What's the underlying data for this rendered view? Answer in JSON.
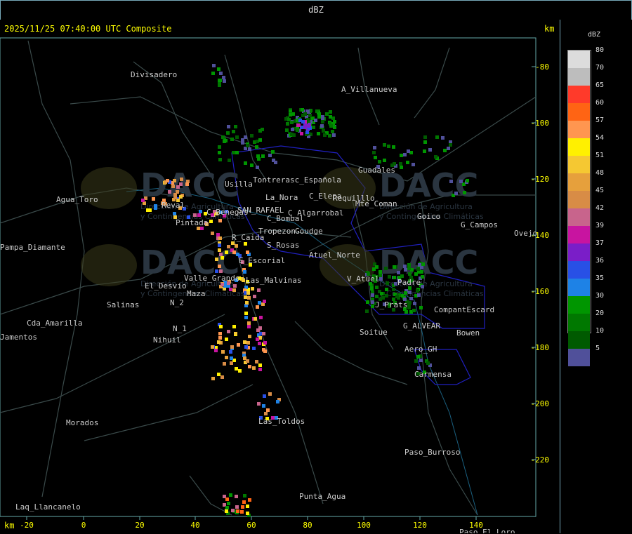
{
  "window": {
    "title": "dBZ"
  },
  "map": {
    "timestamp": "2025/11/25 07:40:00 UTC Composite",
    "km_label": "km",
    "x_ticks": [
      "-20",
      "0",
      "20",
      "40",
      "60",
      "80",
      "100",
      "120",
      "140"
    ],
    "y_ticks": [
      "-80",
      "-100",
      "-120",
      "-140",
      "-160",
      "-180",
      "-200",
      "-220"
    ],
    "places": [
      "Divisadero",
      "A_Villanueva",
      "Guadales",
      "Tontrerasc_Española",
      "Usilla",
      "La_Nora",
      "C_Elepa",
      "Requilllo",
      "Mte_Coman",
      "Goico",
      "G_Campos",
      "Ovejo",
      "Agua_Toro",
      "Pampa_Diamante",
      "Pintada",
      "C_Bombal",
      "C_Benegas",
      "SAN_RAFAEL",
      "C_Algarrobal",
      "Tropezon",
      "Goudge",
      "R_Caida",
      "S_Rosas",
      "Atuel_Norte",
      "E_Escorial",
      "Las_Malvinas",
      "Valle_Grande",
      "V_Atuel",
      "Padre",
      "El_Desvio",
      "Salinas",
      "N_2",
      "N_1",
      "Nihuil",
      "Cda_Amarilla",
      "Jamentos",
      "J_Prats",
      "CompantEscard",
      "G_ALVEAR",
      "Bowen",
      "Soitue",
      "Aero_GH",
      "Carmensa",
      "Las_Toldos",
      "Morados",
      "Paso_Burroso",
      "Punta_Agua",
      "Laq_Llancanelo",
      "Paso_El_Loro",
      "Reval",
      "Maza"
    ],
    "watermark": {
      "brand": "DACC",
      "lines": [
        "Dirección de Agricultura",
        "y Contingencias Climáticas"
      ]
    }
  },
  "legend": {
    "title": "dBZ",
    "entries": [
      {
        "label": "80",
        "color": "#dcdcdc"
      },
      {
        "label": "70",
        "color": "#bdbdbd"
      },
      {
        "label": "65",
        "color": "#ff3a2a"
      },
      {
        "label": "60",
        "color": "#ff6414"
      },
      {
        "label": "57",
        "color": "#ff9650"
      },
      {
        "label": "54",
        "color": "#fff000"
      },
      {
        "label": "51",
        "color": "#f5c832"
      },
      {
        "label": "48",
        "color": "#e6a03c"
      },
      {
        "label": "45",
        "color": "#d88c46"
      },
      {
        "label": "42",
        "color": "#c8648c"
      },
      {
        "label": "39",
        "color": "#c814a0"
      },
      {
        "label": "37",
        "color": "#7a1ec8"
      },
      {
        "label": "36",
        "color": "#2850e6"
      },
      {
        "label": "35",
        "color": "#1e82e6"
      },
      {
        "label": "30",
        "color": "#009600"
      },
      {
        "label": "20",
        "color": "#007800"
      },
      {
        "label": "10",
        "color": "#005a00"
      },
      {
        "label": "5",
        "color": "#50509a"
      }
    ]
  }
}
